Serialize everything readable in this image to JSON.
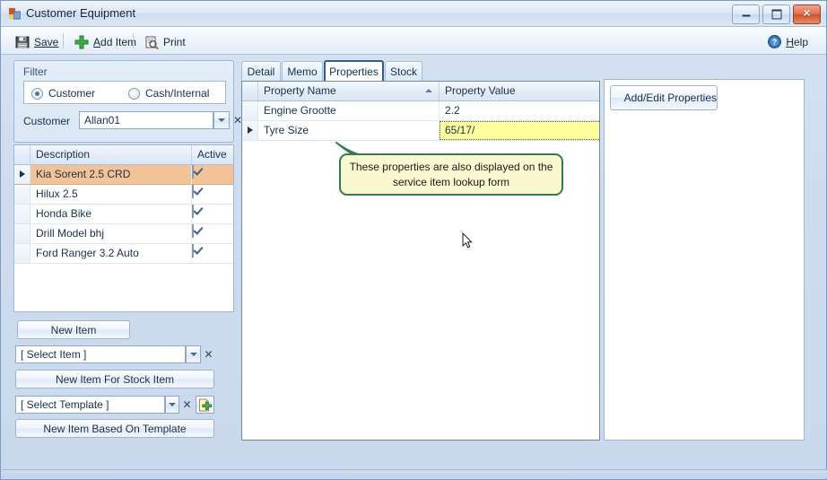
{
  "window": {
    "title": "Customer Equipment",
    "icon": "app-window-icon",
    "minimize": "–",
    "maximize": "□",
    "close": "✕"
  },
  "toolbar": {
    "save_label": "Save",
    "add_item_label": "Add Item",
    "print_label": "Print",
    "help_label": "Help"
  },
  "filter": {
    "panel_title": "Filter",
    "radio_customer": "Customer",
    "radio_cash_internal": "Cash/Internal",
    "selected_radio": "Customer",
    "customer_label": "Customer",
    "customer_value": "Allan01",
    "dropdown_glyph": "▾",
    "clear_glyph": "✕"
  },
  "equipment_grid": {
    "columns": [
      "Description",
      "Active"
    ],
    "rows": [
      {
        "description": "Kia Sorent 2.5 CRD",
        "active": true,
        "selected": true
      },
      {
        "description": "Hilux 2.5",
        "active": true,
        "selected": false
      },
      {
        "description": "Honda Bike",
        "active": true,
        "selected": false
      },
      {
        "description": "Drill Model bhj",
        "active": true,
        "selected": false
      },
      {
        "description": "Ford Ranger 3.2 Auto",
        "active": true,
        "selected": false
      }
    ]
  },
  "left_actions": {
    "new_item": "New Item",
    "select_item_value": "[ Select Item ]",
    "new_item_for_stock_item": "New Item For Stock Item",
    "select_template_value": "[ Select Template ]",
    "new_item_based_on_template": "New Item Based On Template",
    "dropdown_glyph": "▾",
    "clear_glyph": "✕"
  },
  "tabs": [
    {
      "label": "Detail",
      "active": false
    },
    {
      "label": "Memo",
      "active": false
    },
    {
      "label": "Properties",
      "active": true
    },
    {
      "label": "Stock",
      "active": false
    }
  ],
  "properties_grid": {
    "columns": [
      "Property Name",
      "Property Value"
    ],
    "sort_column": "Property Name",
    "sort_direction": "asc",
    "rows": [
      {
        "name": "Engine Grootte",
        "value": "2.2",
        "current": false,
        "editing": false
      },
      {
        "name": "Tyre Size",
        "value": "65/17/",
        "current": true,
        "editing": true
      }
    ]
  },
  "side_panel": {
    "add_edit_properties": "Add/Edit Properties"
  },
  "callout": {
    "text": "These properties are also displayed on the service item lookup form"
  },
  "colors": {
    "accent": "#2f5c9e",
    "selected_row": "#f2c396",
    "edit_cell": "#ffff9e",
    "callout_border": "#2e7d4f",
    "callout_fill": "#fbf8d0",
    "close_button": "#cf4f28"
  }
}
